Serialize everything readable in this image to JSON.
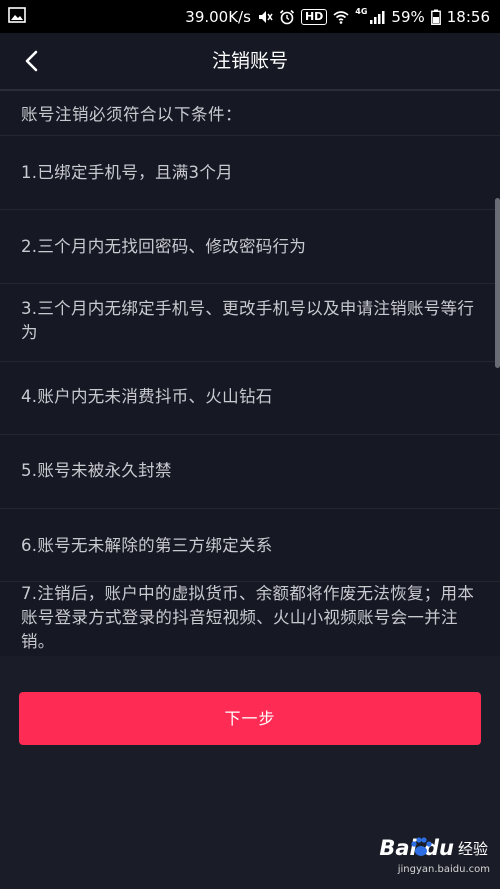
{
  "status_bar": {
    "speed": "39.00K/s",
    "hd": "HD",
    "network": "4G",
    "battery": "59%",
    "time": "18:56"
  },
  "nav": {
    "title": "注销账号"
  },
  "content": {
    "heading": "账号注销必须符合以下条件：",
    "conditions": [
      "1.已绑定手机号，且满3个月",
      "2.三个月内无找回密码、修改密码行为",
      "3.三个月内无绑定手机号、更改手机号以及申请注销账号等行为",
      "4.账户内无未消费抖币、火山钻石",
      "5.账号未被永久封禁",
      "6.账号无未解除的第三方绑定关系",
      "7.注销后，账户中的虚拟货币、余额都将作废无法恢复；用本账号登录方式登录的抖音短视频、火山小视频账号会一并注销。"
    ]
  },
  "footer": {
    "next_button": "下一步"
  },
  "watermark": {
    "logo": "Bai du",
    "logo_suffix": "经验",
    "url": "jingyan.baidu.com"
  },
  "colors": {
    "background": "#161823",
    "accent": "#fe2c55",
    "text": "#c9cad0"
  }
}
